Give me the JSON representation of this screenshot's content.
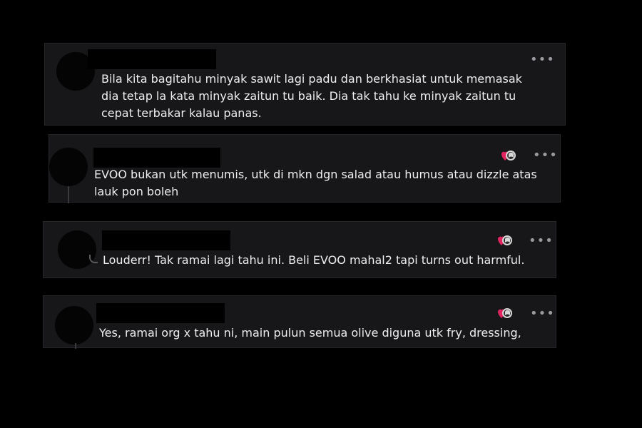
{
  "comments": [
    {
      "text": "Bila kita bagitahu minyak sawit lagi padu dan berkhasiat untuk memasak dia tetap la kata minyak zaitun tu baik. Dia tak tahu ke minyak zaitun tu cepat terbakar kalau panas.",
      "more_icon": "•••"
    },
    {
      "text": "EVOO bukan utk menumis, utk di mkn dgn salad atau humus atau dizzle atas lauk pon boleh",
      "more_icon": "•••",
      "reaction_icon": "heart-reaction-icon"
    },
    {
      "text": "Louderr! Tak ramai lagi tahu ini. Beli EVOO mahal2 tapi turns out harmful.",
      "more_icon": "•••",
      "reaction_icon": "heart-reaction-icon"
    },
    {
      "text": "Yes, ramai org x tahu ni, main pulun semua olive diguna utk fry, dressing,",
      "more_icon": "•••",
      "reaction_icon": "heart-reaction-icon"
    }
  ],
  "colors": {
    "background": "#000000",
    "card": "#17171a",
    "text": "#eeeeee",
    "heart": "#e0245e"
  }
}
